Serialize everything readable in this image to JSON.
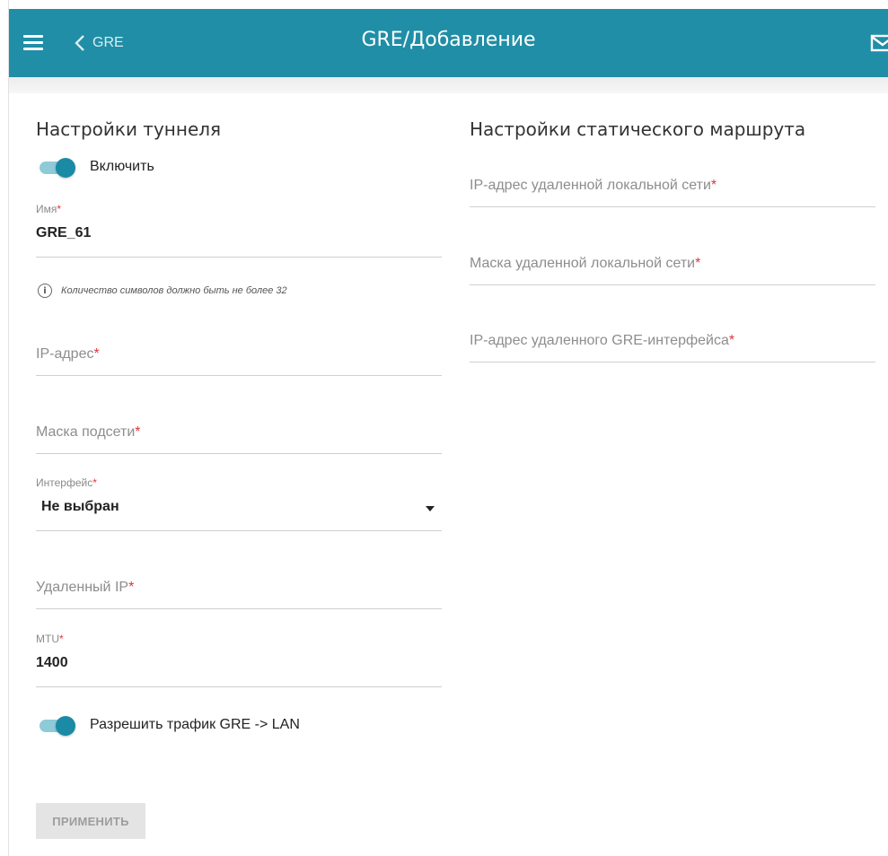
{
  "header": {
    "back_label": "GRE",
    "title": "GRE/Добавление"
  },
  "tunnel": {
    "section_title": "Настройки туннеля",
    "enable_label": "Включить",
    "enable_on": true,
    "name": {
      "label": "Имя",
      "value": "GRE_61"
    },
    "name_hint": "Количество символов должно быть не более 32",
    "ip": {
      "placeholder": "IP-адрес"
    },
    "mask": {
      "placeholder": "Маска подсети"
    },
    "interface": {
      "label": "Интерфейс",
      "value": "Не выбран"
    },
    "remote_ip": {
      "placeholder": "Удаленный IP"
    },
    "mtu": {
      "label": "MTU",
      "value": "1400"
    },
    "allow_label": "Разрешить трафик GRE -> LAN",
    "allow_on": true
  },
  "route": {
    "section_title": "Настройки статического маршрута",
    "remote_net_ip": {
      "placeholder": "IP-адрес удаленной локальной сети"
    },
    "remote_net_mask": {
      "placeholder": "Маска удаленной локальной сети"
    },
    "remote_gre_ip": {
      "placeholder": "IP-адрес удаленного GRE-интерфейса"
    }
  },
  "required_mark": "*",
  "apply_label": "ПРИМЕНИТЬ",
  "icons": {
    "menu": "hamburger-icon",
    "back": "chevron-left-icon",
    "mail": "envelope-icon",
    "info": "info-icon",
    "dropdown": "caret-down-icon"
  },
  "colors": {
    "header_bg": "#1f8ea6",
    "toggle_on": "#1a8aa5",
    "required": "#e0343b",
    "button_disabled_bg": "#e4e4e4"
  }
}
